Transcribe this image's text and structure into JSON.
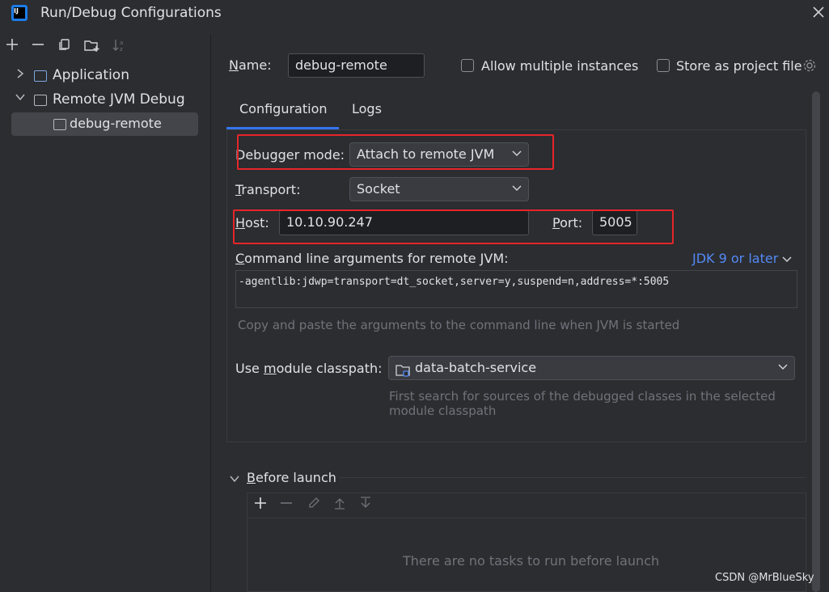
{
  "window": {
    "title": "Run/Debug Configurations",
    "close_icon": "close-icon"
  },
  "sidebar": {
    "toolbar": [
      "add-icon",
      "remove-icon",
      "copy-icon",
      "new-folder-icon",
      "sort-icon"
    ],
    "tree": [
      {
        "label": "Application",
        "expanded": false
      },
      {
        "label": "Remote JVM Debug",
        "expanded": true
      },
      {
        "label": "debug-remote",
        "selected": true
      }
    ]
  },
  "form": {
    "name_label": "Name:",
    "name_value": "debug-remote",
    "allow_multiple_label": "Allow multiple instances",
    "store_project_label": "Store as project file"
  },
  "tabs": [
    {
      "label": "Configuration",
      "active": true
    },
    {
      "label": "Logs",
      "active": false
    }
  ],
  "config": {
    "debugger_mode_label": "Debugger mode:",
    "debugger_mode_value": "Attach to remote JVM",
    "transport_label": "Transport:",
    "transport_value": "Socket",
    "host_label": "Host:",
    "host_value": "10.10.90.247",
    "port_label": "Port:",
    "port_value": "5005",
    "cmd_label": "Command line arguments for remote JVM:",
    "jdk_link": "JDK 9 or later",
    "cmd_value": "-agentlib:jdwp=transport=dt_socket,server=y,suspend=n,address=*:5005",
    "cmd_hint": "Copy and paste the arguments to the command line when JVM is started",
    "module_label": "Use module classpath:",
    "module_value": "data-batch-service",
    "module_hint": "First search for sources of the debugged classes in the selected module classpath"
  },
  "before_launch": {
    "title": "Before launch",
    "empty_text": "There are no tasks to run before launch"
  },
  "watermark": "CSDN @MrBlueSky",
  "colors": {
    "accent": "#3574f0",
    "link": "#548af7",
    "highlight": "#e5252a",
    "background": "#2b2d30"
  }
}
